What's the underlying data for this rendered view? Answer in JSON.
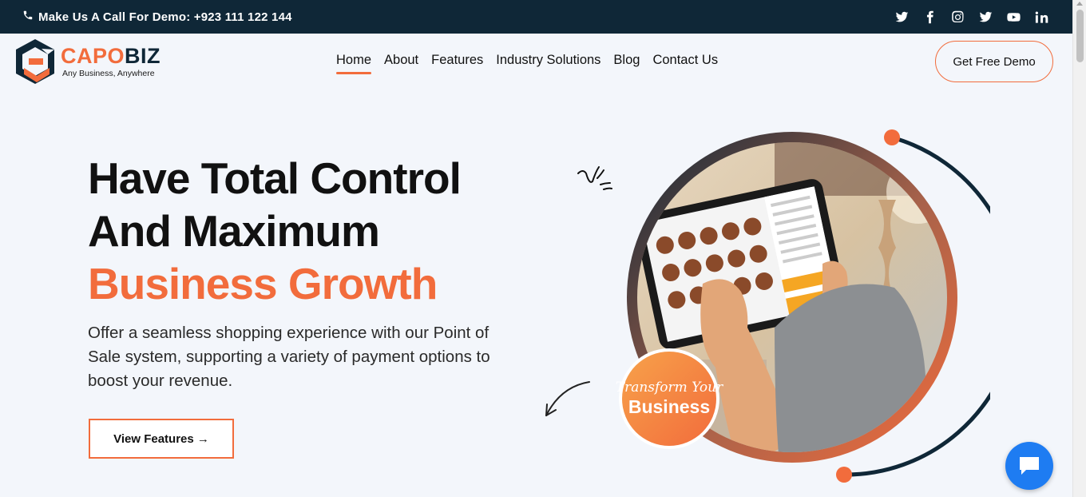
{
  "topbar": {
    "call_text": "Make Us A Call For Demo: +923 111 122 144",
    "socials": [
      "twitter-icon",
      "facebook-icon",
      "instagram-icon",
      "twitter-icon",
      "youtube-icon",
      "linkedin-icon"
    ]
  },
  "brand": {
    "name_part1": "CAPO",
    "name_part2": "BIZ",
    "tagline": "Any Business, Anywhere",
    "accent_color": "#f26c3c",
    "dark_color": "#0f2737"
  },
  "nav": {
    "items": [
      {
        "label": "Home",
        "active": true
      },
      {
        "label": "About",
        "active": false
      },
      {
        "label": "Features",
        "active": false
      },
      {
        "label": "Industry Solutions",
        "active": false
      },
      {
        "label": "Blog",
        "active": false
      },
      {
        "label": "Contact Us",
        "active": false
      }
    ],
    "cta_label": "Get Free Demo"
  },
  "hero": {
    "title_line1": "Have Total Control",
    "title_line2": "And Maximum",
    "title_accent": "Business Growth",
    "description": "Offer a seamless shopping experience with our Point of Sale system, supporting a variety of payment options to boost your revenue.",
    "button_label": "View Features →",
    "badge_line1": "Transform Your",
    "badge_line2": "Business"
  },
  "chat": {
    "icon": "chat-icon"
  }
}
